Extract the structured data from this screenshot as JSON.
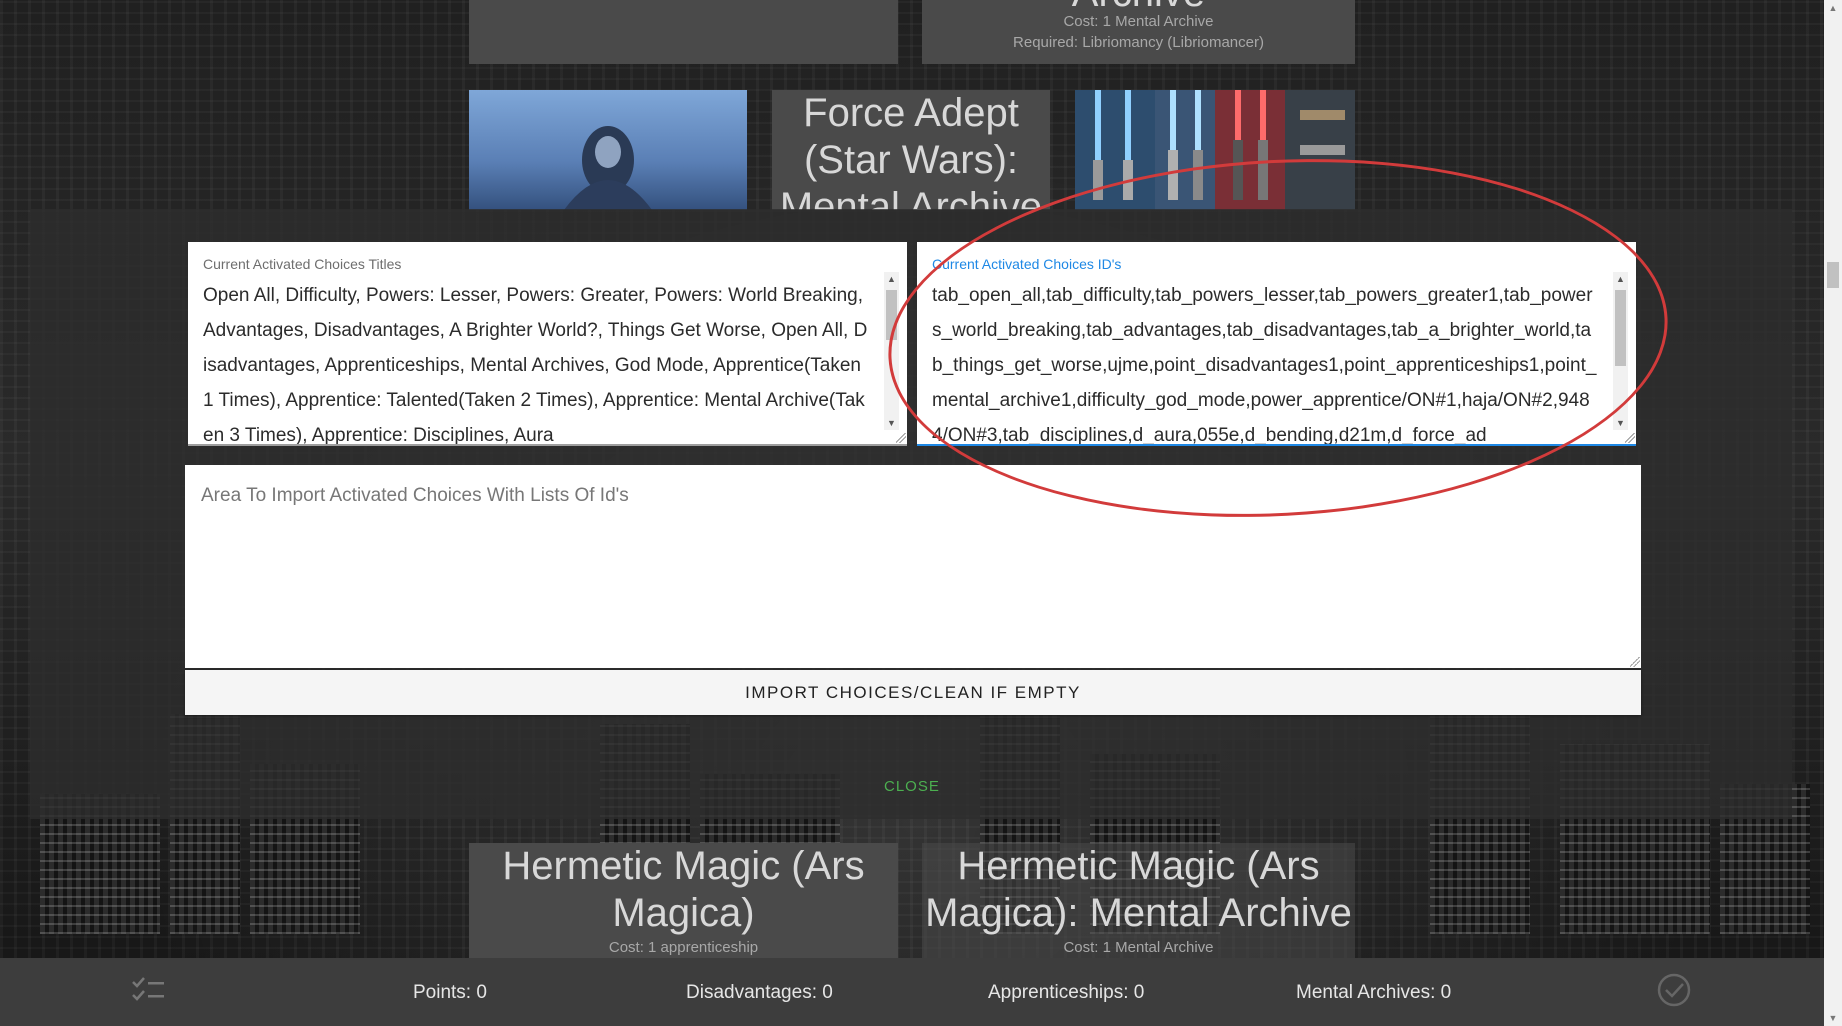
{
  "background_cards": {
    "top_left": {
      "title": ""
    },
    "top_right": {
      "title": "Archive",
      "cost": "Cost: 1 Mental Archive",
      "required": "Required: Libriomancy (Libriomancer)"
    },
    "force_adept": {
      "title": "Force Adept (Star Wars): Mental Archive"
    },
    "hermetic_left": {
      "title": "Hermetic Magic (Ars Magica)",
      "cost": "Cost: 1 apprenticeship"
    },
    "hermetic_right": {
      "title": "Hermetic Magic (Ars Magica): Mental Archive",
      "cost": "Cost: 1 Mental Archive"
    }
  },
  "modal": {
    "titles_field": {
      "label": "Current Activated Choices Titles",
      "value": "Open All, Difficulty, Powers: Lesser, Powers: Greater, Powers: World Breaking, Advantages, Disadvantages, A Brighter World?, Things Get Worse, Open All, Disadvantages, Apprenticeships, Mental Archives, God Mode, Apprentice(Taken 1 Times), Apprentice: Talented(Taken 2 Times), Apprentice: Mental Archive(Taken 3 Times), Apprentice: Disciplines, Aura"
    },
    "ids_field": {
      "label": "Current Activated Choices ID's",
      "value": "tab_open_all,tab_difficulty,tab_powers_lesser,tab_powers_greater1,tab_powers_world_breaking,tab_advantages,tab_disadvantages,tab_a_brighter_world,tab_things_get_worse,ujme,point_disadvantages1,point_apprenticeships1,point_mental_archive1,difficulty_god_mode,power_apprentice/ON#1,haja/ON#2,9484/ON#3,tab_disciplines,d_aura,055e,d_bending,d21m,d_force_ad"
    },
    "import_area": {
      "placeholder": "Area To Import Activated Choices With Lists Of Id's"
    },
    "import_button": "IMPORT CHOICES/CLEAN IF EMPTY",
    "close_label": "CLOSE"
  },
  "footer": {
    "points": "Points: 0",
    "disadvantages": "Disadvantages: 0",
    "apprenticeships": "Apprenticeships: 0",
    "mental_archives": "Mental Archives: 0"
  },
  "icons": {
    "left": "list-check-icon",
    "right": "check-circle-icon"
  },
  "colors": {
    "accent_blue": "#1e88e5",
    "close_green": "#4caf50",
    "annotation_red": "#d23b3b"
  }
}
